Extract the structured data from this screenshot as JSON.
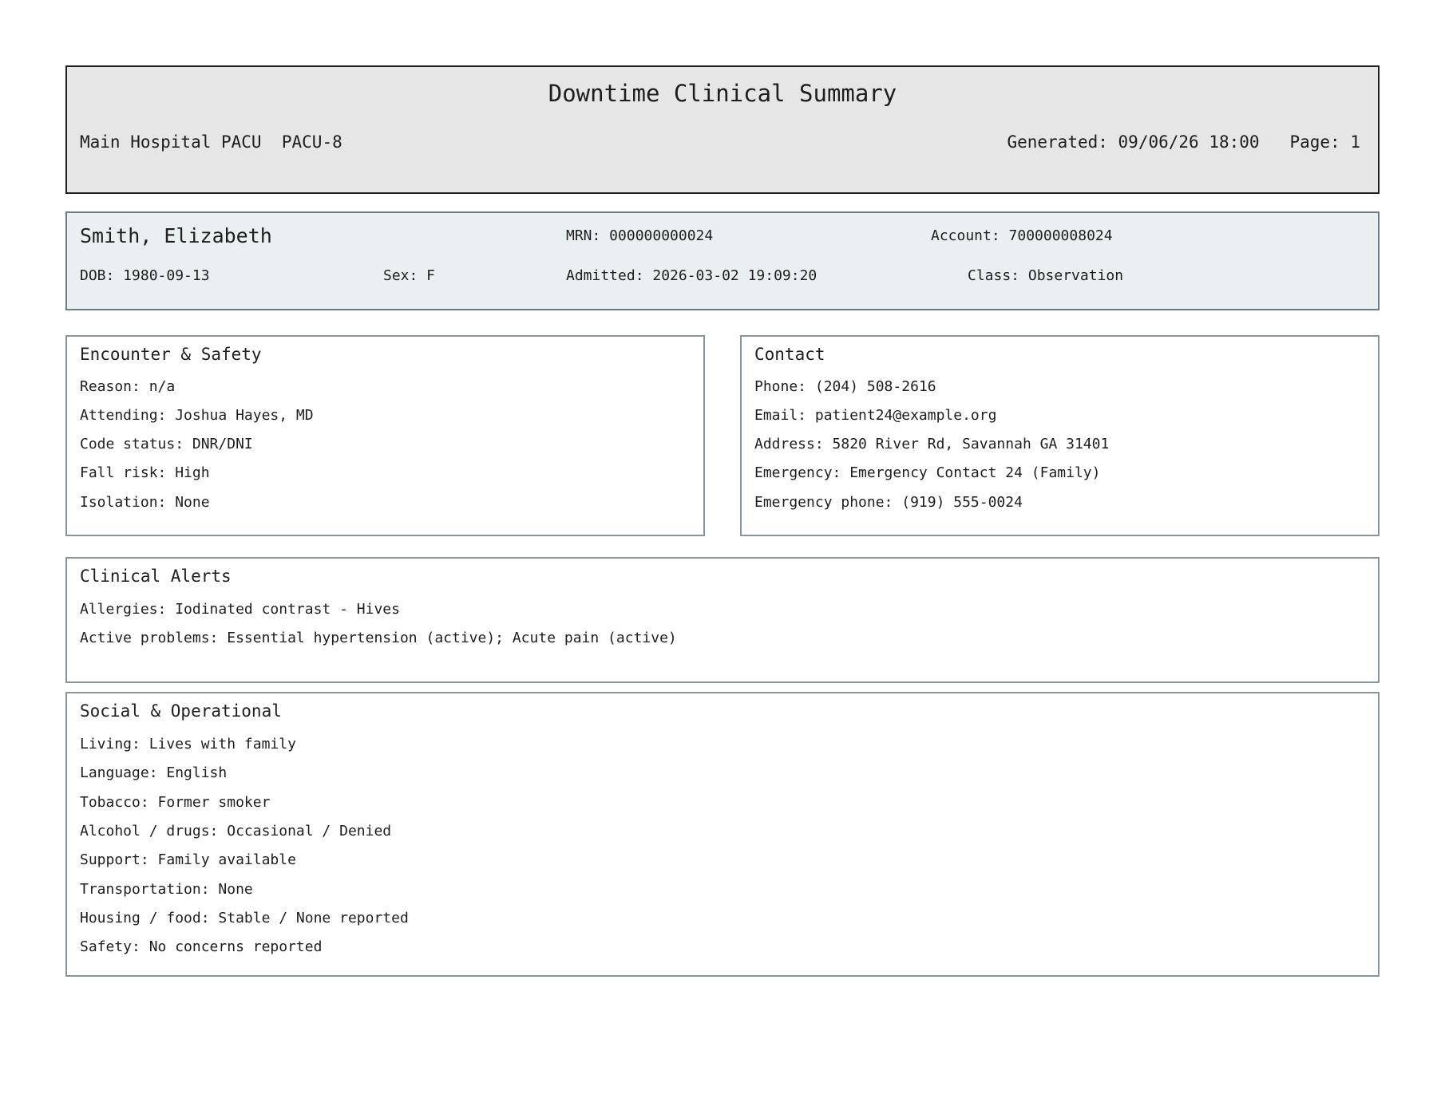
{
  "header": {
    "title": "Downtime Clinical Summary",
    "location": "Main Hospital PACU",
    "bed": "PACU-8",
    "generated": "Generated: 09/06/26 18:00",
    "page": "Page: 1"
  },
  "patient": {
    "name": "Smith, Elizabeth",
    "mrn": "MRN: 000000000024",
    "account": "Account: 700000008024",
    "dob": "DOB: 1980-09-13",
    "sex": "Sex: F",
    "admitted": "Admitted: 2026-03-02 19:09:20",
    "class": "Class: Observation"
  },
  "encounter": {
    "title": "Encounter & Safety",
    "lines": [
      "Reason: n/a",
      "Attending: Joshua Hayes, MD",
      "Code status: DNR/DNI",
      "Fall risk: High",
      "Isolation: None"
    ]
  },
  "contact": {
    "title": "Contact",
    "lines": [
      "Phone: (204) 508-2616",
      "Email: patient24@example.org",
      "Address: 5820 River Rd, Savannah GA 31401",
      "Emergency: Emergency Contact 24 (Family)",
      "Emergency phone: (919) 555-0024"
    ]
  },
  "alerts": {
    "title": "Clinical Alerts",
    "lines": [
      "Allergies: Iodinated contrast - Hives",
      "Active problems: Essential hypertension (active); Acute pain (active)"
    ]
  },
  "social": {
    "title": "Social & Operational",
    "lines": [
      "Living: Lives with family",
      "Language: English",
      "Tobacco: Former smoker",
      "Alcohol / drugs: Occasional / Denied",
      "Support: Family available",
      "Transportation: None",
      "Housing / food: Stable / None reported",
      "Safety: No concerns reported"
    ]
  }
}
